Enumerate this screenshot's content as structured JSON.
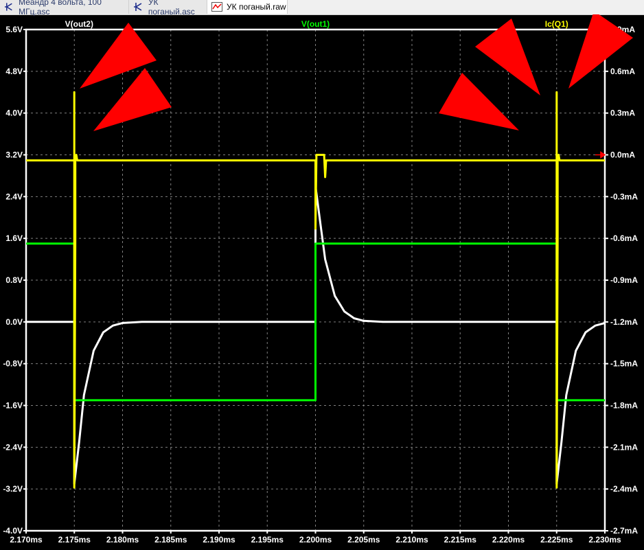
{
  "tabs": [
    {
      "label": "Меандр 4 вольта, 100 МГц.asc",
      "icon": "schematic-icon",
      "active": false
    },
    {
      "label": "УК поганый.asc",
      "icon": "schematic-icon",
      "active": false
    },
    {
      "label": "УК поганый.raw",
      "icon": "waveform-icon",
      "active": true
    }
  ],
  "colors": {
    "background": "#000000",
    "axis": "#ffffff",
    "grid": "#808080",
    "v_out2": "#ffffff",
    "v_out1": "#00ff00",
    "ic_q1": "#ffff00",
    "annotation": "#ff0000"
  },
  "chart_data": {
    "type": "line",
    "title": "",
    "xlabel": "",
    "x_unit": "ms",
    "xlim": [
      2.17,
      2.23
    ],
    "x_ticks": [
      "2.170ms",
      "2.175ms",
      "2.180ms",
      "2.185ms",
      "2.190ms",
      "2.195ms",
      "2.200ms",
      "2.205ms",
      "2.210ms",
      "2.215ms",
      "2.220ms",
      "2.225ms",
      "2.230ms"
    ],
    "y_left": {
      "unit": "V",
      "ylim": [
        -4.0,
        5.6
      ],
      "ticks": [
        "5.6V",
        "4.8V",
        "4.0V",
        "3.2V",
        "2.4V",
        "1.6V",
        "0.8V",
        "0.0V",
        "-0.8V",
        "-1.6V",
        "-2.4V",
        "-3.2V",
        "-4.0V"
      ]
    },
    "y_right": {
      "unit": "mA",
      "ylim": [
        -2.7,
        0.9
      ],
      "ticks": [
        "0.9mA",
        "0.6mA",
        "0.3mA",
        "0.0mA",
        "-0.3mA",
        "-0.6mA",
        "-0.9mA",
        "-1.2mA",
        "-1.5mA",
        "-1.8mA",
        "-2.1mA",
        "-2.4mA",
        "-2.7mA"
      ]
    },
    "grid": true,
    "series": [
      {
        "name": "V(out2)",
        "axis": "left",
        "color": "#ffffff",
        "points": [
          [
            2.17,
            0
          ],
          [
            2.175,
            0
          ],
          [
            2.175,
            -3.1
          ],
          [
            2.1755,
            -2.3
          ],
          [
            2.176,
            -1.4
          ],
          [
            2.177,
            -0.55
          ],
          [
            2.178,
            -0.2
          ],
          [
            2.179,
            -0.07
          ],
          [
            2.18,
            -0.02
          ],
          [
            2.182,
            0
          ],
          [
            2.2,
            0
          ],
          [
            2.2,
            2.6
          ],
          [
            2.2005,
            1.9
          ],
          [
            2.201,
            1.2
          ],
          [
            2.202,
            0.5
          ],
          [
            2.203,
            0.2
          ],
          [
            2.204,
            0.07
          ],
          [
            2.205,
            0.02
          ],
          [
            2.207,
            0
          ],
          [
            2.225,
            0
          ],
          [
            2.225,
            -3.1
          ],
          [
            2.2255,
            -2.3
          ],
          [
            2.226,
            -1.4
          ],
          [
            2.227,
            -0.55
          ],
          [
            2.228,
            -0.2
          ],
          [
            2.229,
            -0.07
          ],
          [
            2.23,
            -0.02
          ]
        ]
      },
      {
        "name": "V(out1)",
        "axis": "left",
        "color": "#00ff00",
        "points": [
          [
            2.17,
            1.5
          ],
          [
            2.175,
            1.5
          ],
          [
            2.175,
            -1.5
          ],
          [
            2.2,
            -1.5
          ],
          [
            2.2,
            1.5
          ],
          [
            2.225,
            1.5
          ],
          [
            2.225,
            -1.5
          ],
          [
            2.23,
            -1.5
          ]
        ]
      },
      {
        "name": "Ic(Q1)",
        "axis": "right",
        "color": "#ffff00",
        "points": [
          [
            2.17,
            -0.04
          ],
          [
            2.175,
            -0.04
          ],
          [
            2.175,
            0.45
          ],
          [
            2.175,
            -2.39
          ],
          [
            2.1751,
            -0.6
          ],
          [
            2.1751,
            -0.04
          ],
          [
            2.1752,
            0.0
          ],
          [
            2.1753,
            -0.04
          ],
          [
            2.2,
            -0.04
          ],
          [
            2.2,
            -0.53
          ],
          [
            2.2001,
            0.0
          ],
          [
            2.2009,
            0.0
          ],
          [
            2.201,
            -0.16
          ],
          [
            2.2011,
            -0.04
          ],
          [
            2.225,
            -0.04
          ],
          [
            2.225,
            0.45
          ],
          [
            2.225,
            -2.39
          ],
          [
            2.2251,
            -0.6
          ],
          [
            2.2251,
            -0.04
          ],
          [
            2.2252,
            0.0
          ],
          [
            2.2253,
            -0.04
          ],
          [
            2.23,
            -0.04
          ]
        ]
      }
    ]
  }
}
